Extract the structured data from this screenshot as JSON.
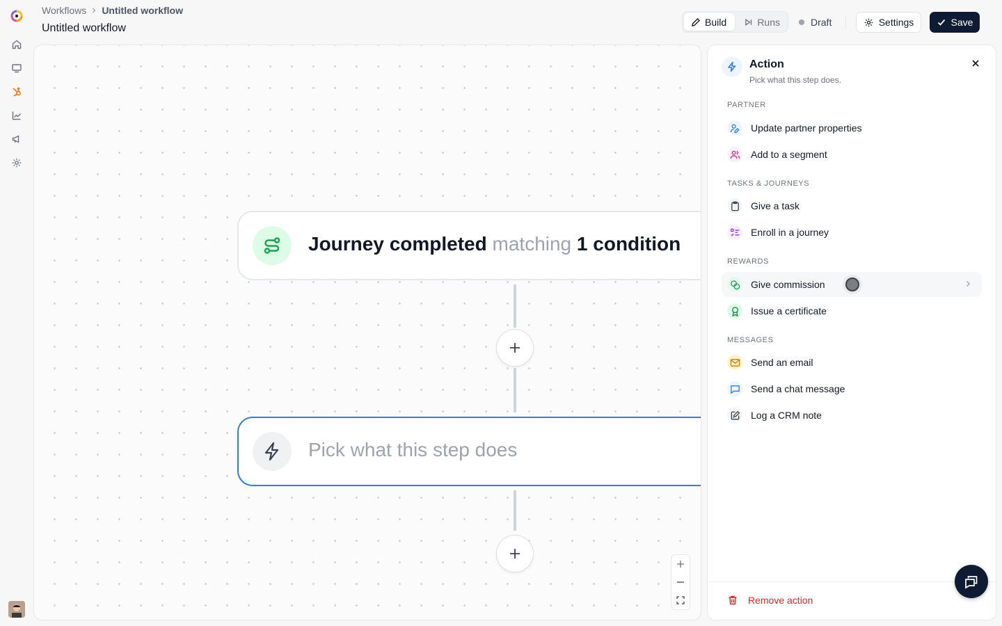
{
  "header": {
    "breadcrumb_root": "Workflows",
    "breadcrumb_current": "Untitled workflow",
    "title": "Untitled workflow"
  },
  "toolbar": {
    "build_label": "Build",
    "runs_label": "Runs",
    "status_label": "Draft",
    "settings_label": "Settings",
    "save_label": "Save"
  },
  "sidebar": {
    "items": [
      {
        "icon": "home-icon"
      },
      {
        "icon": "monitor-icon"
      },
      {
        "icon": "hubspot-icon",
        "active": true
      },
      {
        "icon": "chart-icon"
      },
      {
        "icon": "megaphone-icon"
      },
      {
        "icon": "gear-icon"
      }
    ]
  },
  "canvas": {
    "trigger": {
      "event": "Journey completed",
      "connector": "matching",
      "condition": "1 condition"
    },
    "action": {
      "placeholder": "Pick what this step does"
    }
  },
  "panel": {
    "title": "Action",
    "subtitle": "Pick what this step does.",
    "sections": [
      {
        "label": "PARTNER",
        "items": [
          "Update partner properties",
          "Add to a segment"
        ]
      },
      {
        "label": "TASKS & JOURNEYS",
        "items": [
          "Give a task",
          "Enroll in a journey"
        ]
      },
      {
        "label": "REWARDS",
        "items": [
          "Give commission",
          "Issue a certificate"
        ]
      },
      {
        "label": "MESSAGES",
        "items": [
          "Send an email",
          "Send a chat message",
          "Log a CRM note"
        ]
      }
    ],
    "remove_label": "Remove action"
  },
  "colors": {
    "accent": "#2f7be0",
    "primary_button": "#0f1b33",
    "danger": "#dc2626",
    "trigger_icon_bg": "#dcfce7",
    "trigger_icon_fg": "#16a34a"
  }
}
